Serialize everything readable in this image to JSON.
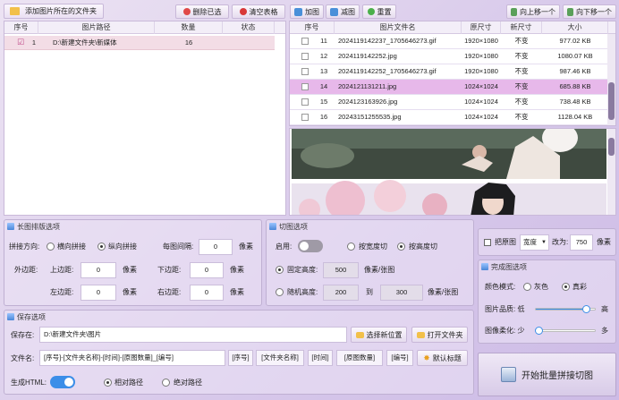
{
  "toolbar": {
    "add_folder": "添加图片所在的文件夹",
    "delete_selected": "删除已选",
    "clear_table": "清空表格",
    "add_image": "加图",
    "remove_image": "减图",
    "reset": "重置",
    "move_up": "向上移一个",
    "move_down": "向下移一个"
  },
  "folder_table": {
    "headers": [
      "序号",
      "图片路径",
      "数量",
      "状态"
    ],
    "rows": [
      {
        "index": "1",
        "path": "D:\\新建文件夹\\新媒体",
        "count": "16",
        "status": ""
      }
    ]
  },
  "image_table": {
    "headers": [
      "序号",
      "图片文件名",
      "原尺寸",
      "新尺寸",
      "大小"
    ],
    "rows": [
      {
        "index": "11",
        "name": "2024119142237_1705646273.gif",
        "orig": "1920×1080",
        "new": "不变",
        "size": "977.02 KB"
      },
      {
        "index": "12",
        "name": "2024119142252.jpg",
        "orig": "1920×1080",
        "new": "不变",
        "size": "1080.07 KB"
      },
      {
        "index": "13",
        "name": "2024119142252_1705646273.gif",
        "orig": "1920×1080",
        "new": "不变",
        "size": "987.46 KB"
      },
      {
        "index": "14",
        "name": "2024121131211.jpg",
        "orig": "1024×1024",
        "new": "不变",
        "size": "685.88 KB"
      },
      {
        "index": "15",
        "name": "2024123163926.jpg",
        "orig": "1024×1024",
        "new": "不变",
        "size": "738.48 KB"
      },
      {
        "index": "16",
        "name": "20243151255535.jpg",
        "orig": "1024×1024",
        "new": "不变",
        "size": "1128.04 KB"
      }
    ]
  },
  "layout_panel": {
    "title": "长图排版选项",
    "direction_label": "拼接方向:",
    "horizontal": "横向拼接",
    "vertical": "纵向拼接",
    "spacing_label": "每图间隔:",
    "spacing_value": "0",
    "unit": "像素",
    "outer_margin_label": "外边距:",
    "top_label": "上边距:",
    "top_value": "0",
    "bottom_label": "下边距:",
    "bottom_value": "0",
    "left_label": "左边距:",
    "left_value": "0",
    "right_label": "右边距:",
    "right_value": "0"
  },
  "cut_panel": {
    "title": "切图选项",
    "enable_label": "启用:",
    "by_width": "按宽度切",
    "by_height": "按高度切",
    "fixed_height_label": "固定高度:",
    "fixed_height_value": "500",
    "fixed_unit": "像素/张图",
    "random_height_label": "随机高度:",
    "random_min": "200",
    "to_label": "到",
    "random_max": "300",
    "random_unit": "像素/张图"
  },
  "resize_panel": {
    "checkbox_label": "把原图",
    "dimension_select": "宽度",
    "change_to": "改为:",
    "value": "750",
    "unit": "像素"
  },
  "finish_panel": {
    "title": "完成图选项",
    "color_mode_label": "颜色模式:",
    "gray": "灰色",
    "true_color": "真彩",
    "quality_label": "图片品质: 低",
    "quality_high": "高",
    "quality_level": 0.85,
    "soften_label": "图像柔化: 少",
    "soften_more": "多",
    "soften_level": 0.05
  },
  "save_panel": {
    "title": "保存选项",
    "save_to_label": "保存在:",
    "save_path": "D:\\新建文件夹\\图片",
    "choose_location": "选择新位置",
    "open_folder": "打开文件夹",
    "filename_label": "文件名:",
    "filename_pattern": "[序号]-[文件夹名称]-[时间]-[原图数量]_[编号]",
    "tags": [
      "[序号]",
      "[文件夹名称]",
      "[时间]",
      "[原图数量]",
      "[编号]"
    ],
    "default_label": "默认标题",
    "html_label": "生成HTML:",
    "relative_path": "相对路径",
    "absolute_path": "绝对路径"
  },
  "start_button": "开始批量拼接切图",
  "colors": {
    "accent_blue": "#3c8ee8",
    "selected_row": "#e7b8ea",
    "panel_border": "#bfb0d2"
  }
}
